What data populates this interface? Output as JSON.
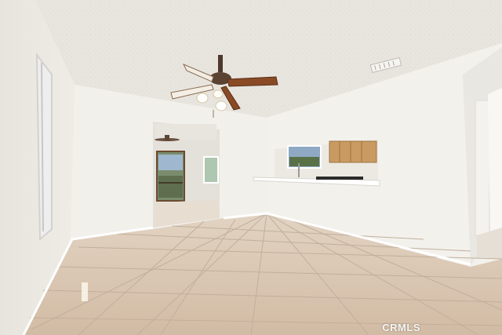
{
  "photo": {
    "subject": "empty-room-interior",
    "watermark": "CRMLS",
    "colors": {
      "ceiling": "#e9e6e0",
      "wall": "#f1efea",
      "floor": "#d9c6b2",
      "grout": "#bfae9c",
      "baseboard": "#ffffff",
      "cabinet": "#c99a62",
      "fan_blade": "#8a4a26"
    }
  }
}
